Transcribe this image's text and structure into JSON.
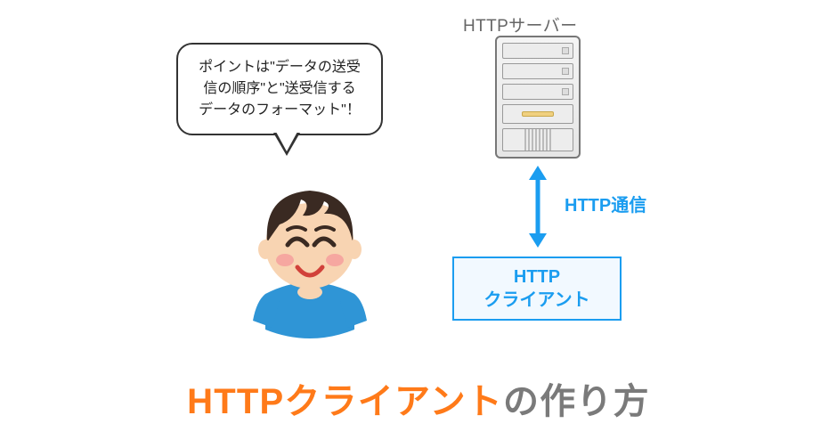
{
  "bubble": {
    "line1": "ポイントは\"データの送受",
    "line2": "信の順序\"と\"送受信する",
    "line3": "データのフォーマット\"！"
  },
  "server": {
    "label": "HTTPサーバー"
  },
  "arrow": {
    "label": "HTTP通信"
  },
  "client": {
    "line1": "HTTP",
    "line2": "クライアント"
  },
  "title": {
    "orange": "HTTPクライアント",
    "gray": "の作り方"
  },
  "colors": {
    "accent": "#1b9df0",
    "title_orange": "#ff7a19",
    "title_gray": "#7a7a7a"
  }
}
